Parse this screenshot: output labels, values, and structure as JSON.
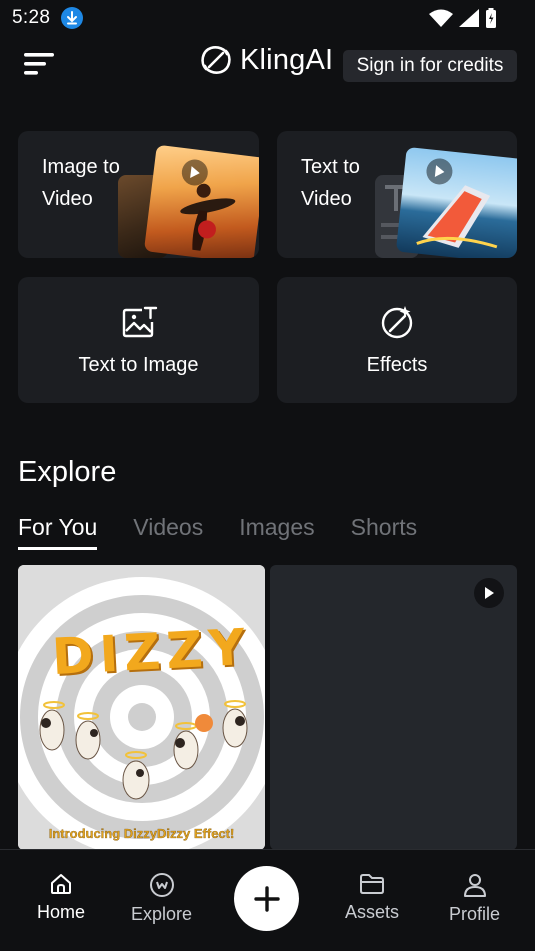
{
  "status": {
    "time": "5:28"
  },
  "header": {
    "logo_text": "KlingAI",
    "sign_in_label": "Sign in for credits"
  },
  "features": {
    "image_to_video": {
      "title": "Image to\nVideo"
    },
    "text_to_video": {
      "title": "Text to\nVideo"
    },
    "text_to_image": {
      "label": "Text to Image"
    },
    "effects": {
      "label": "Effects"
    }
  },
  "explore": {
    "title": "Explore",
    "tabs": [
      {
        "label": "For You",
        "active": true
      },
      {
        "label": "Videos",
        "active": false
      },
      {
        "label": "Images",
        "active": false
      },
      {
        "label": "Shorts",
        "active": false
      }
    ],
    "feed": [
      {
        "art_word": "DIZZY",
        "caption": "Introducing DizzyDizzy Effect!"
      },
      {
        "caption": ""
      }
    ]
  },
  "nav": {
    "home": "Home",
    "explore": "Explore",
    "assets": "Assets",
    "profile": "Profile"
  },
  "colors": {
    "background": "#0f1012",
    "card": "#1c1e22",
    "accent": "#f2a81d"
  }
}
